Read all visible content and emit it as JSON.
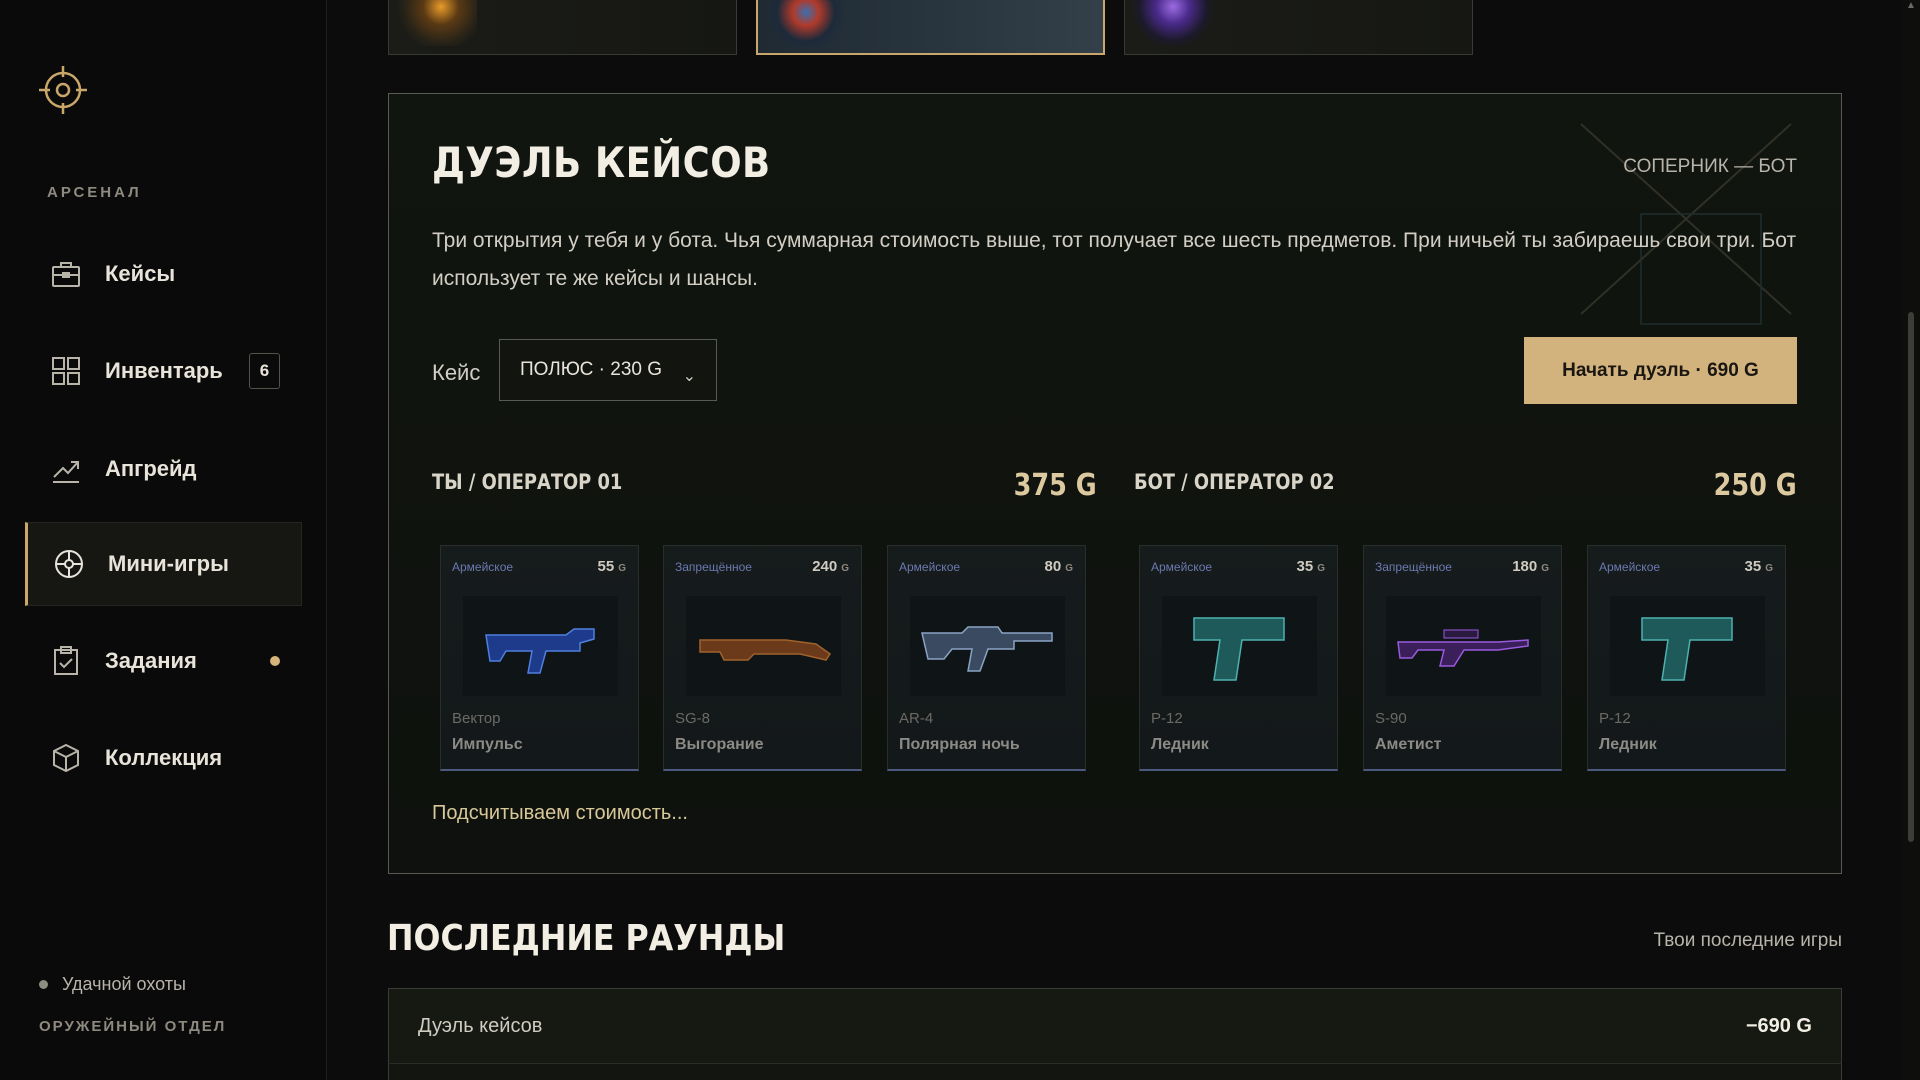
{
  "sidebar": {
    "logo_icon": "crosshair-icon",
    "section_label": "АРСЕНАЛ",
    "items": [
      {
        "label": "Кейсы",
        "icon": "briefcase-icon"
      },
      {
        "label": "Инвентарь",
        "icon": "grid-icon",
        "badge": "6"
      },
      {
        "label": "Апгрейд",
        "icon": "trend-up-icon"
      },
      {
        "label": "Мини-игры",
        "icon": "compass-icon",
        "active": true
      },
      {
        "label": "Задания",
        "icon": "clipboard-icon",
        "has_dot": true
      },
      {
        "label": "Коллекция",
        "icon": "cube-icon"
      }
    ],
    "footer_status": "Удачной охоты",
    "footer_dept": "ОРУЖЕЙНЫЙ ОТДЕЛ"
  },
  "duel": {
    "title": "ДУЭЛЬ КЕЙСОВ",
    "opponent_label": "СОПЕРНИК — БОТ",
    "description": "Три открытия у тебя и у бота. Чья суммарная стоимость выше, тот получает все шесть предметов. При ничьей ты забираешь свои три. Бот использует те же кейсы и шансы.",
    "case_label": "Кейс",
    "case_selected": "ПОЛЮС · 230 G",
    "start_button": "Начать дуэль · 690 G",
    "player": {
      "label": "ТЫ / ОПЕРАТОР 01",
      "total": "375 G",
      "items": [
        {
          "rarity": "Армейское",
          "price": "55",
          "currency": "G",
          "model": "Вектор",
          "skin": "Импульс"
        },
        {
          "rarity": "Запрещённое",
          "price": "240",
          "currency": "G",
          "model": "SG-8",
          "skin": "Выгорание"
        },
        {
          "rarity": "Армейское",
          "price": "80",
          "currency": "G",
          "model": "AR-4",
          "skin": "Полярная ночь"
        }
      ]
    },
    "bot": {
      "label": "БОТ / ОПЕРАТОР 02",
      "total": "250 G",
      "items": [
        {
          "rarity": "Армейское",
          "price": "35",
          "currency": "G",
          "model": "P-12",
          "skin": "Ледник"
        },
        {
          "rarity": "Запрещённое",
          "price": "180",
          "currency": "G",
          "model": "S-90",
          "skin": "Аметист"
        },
        {
          "rarity": "Армейское",
          "price": "35",
          "currency": "G",
          "model": "P-12",
          "skin": "Ледник"
        }
      ]
    },
    "status": "Подсчитываем стоимость..."
  },
  "rounds": {
    "title": "ПОСЛЕДНИЕ РАУНДЫ",
    "link": "Твои последние игры",
    "rows": [
      {
        "name": "Дуэль кейсов",
        "amount": "−690 G"
      }
    ]
  },
  "colors": {
    "accent": "#d2b27d",
    "active_border": "#c9a76a",
    "rarity_blue": "#6b7ab0"
  }
}
